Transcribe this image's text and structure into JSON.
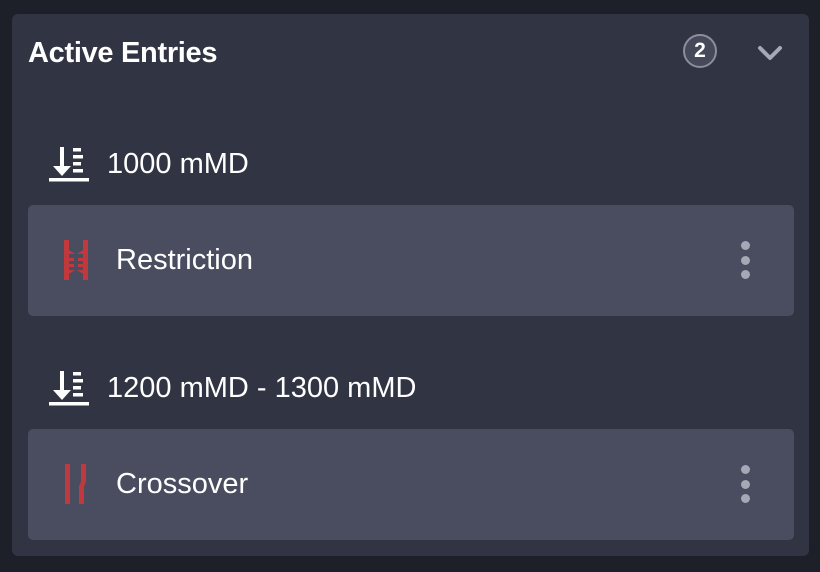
{
  "panel": {
    "title": "Active Entries",
    "count": "2"
  },
  "groups": [
    {
      "depth_label": "1000 mMD",
      "entry": {
        "label": "Restriction",
        "icon": "restriction-icon"
      }
    },
    {
      "depth_label": "1200 mMD - 1300 mMD",
      "entry": {
        "label": "Crossover",
        "icon": "crossover-icon"
      }
    }
  ],
  "icons": {
    "depth": "depth-icon",
    "collapse": "chevron-down-icon",
    "menu": "more-vertical-icon"
  },
  "colors": {
    "background": "#1e2029",
    "panel": "#313442",
    "entry": "#494d5f",
    "accent_red": "#c0393d",
    "text": "#ffffff"
  }
}
